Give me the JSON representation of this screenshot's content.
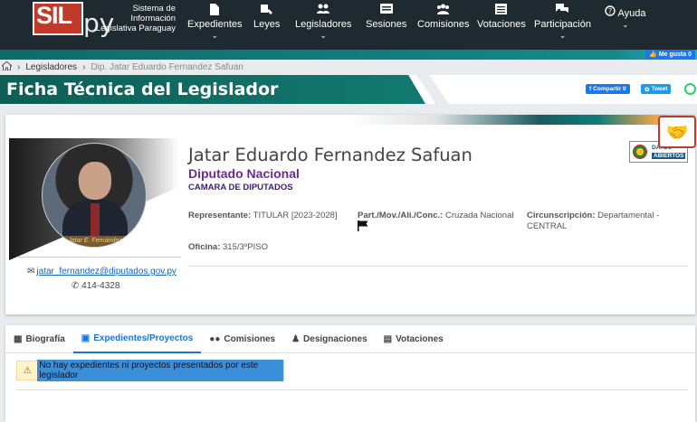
{
  "header": {
    "logo_sil": "SIL",
    "logo_py": "py",
    "logo_caption": "Sistema de Información Legislativa Paraguay",
    "nav": [
      {
        "label": "Expedientes",
        "icon": "document-icon",
        "dropdown": true
      },
      {
        "label": "Leyes",
        "icon": "book-icon",
        "dropdown": false
      },
      {
        "label": "Legisladores",
        "icon": "users-icon",
        "dropdown": true
      },
      {
        "label": "Sesiones",
        "icon": "keyboard-icon",
        "dropdown": false
      },
      {
        "label": "Comisiones",
        "icon": "group-icon",
        "dropdown": false
      },
      {
        "label": "Votaciones",
        "icon": "vote-icon",
        "dropdown": false
      },
      {
        "label": "Participación",
        "icon": "chat-icon",
        "dropdown": true
      },
      {
        "label": "Ayuda",
        "icon": "question-icon",
        "dropdown": true
      }
    ],
    "fb_like": "Me gusta 0"
  },
  "breadcrumb": {
    "items": [
      "Legisladores"
    ],
    "current": "Dip. Jatar Eduardo Fernandez Safuan"
  },
  "title": "Ficha Técnica del Legislador",
  "share": {
    "facebook": "Compartir 0",
    "twitter": "Tweet"
  },
  "profile": {
    "name": "Jatar Eduardo Fernandez Safuan",
    "role": "Diputado Nacional",
    "chamber": "CAMARA DE DIPUTADOS",
    "nameplate": "Jatar E. Fernández",
    "email": "jatar_fernandez@diputados.gov.py",
    "phone": "414-4328",
    "representante_label": "Representante:",
    "representante_value": "TITULAR [2023-2028]",
    "partido_label": "Part./Mov./Ali./Conc.:",
    "partido_value": "Cruzada Nacional",
    "circ_label": "Circunscripción:",
    "circ_value": "Departamental - CENTRAL",
    "oficina_label": "Oficina:",
    "oficina_value": "315/3ºPISO",
    "datos_abiertos_1": "DATOS",
    "datos_abiertos_2": "ABIERTOS"
  },
  "tabs": [
    {
      "label": "Biografía",
      "icon": "id-badge-icon",
      "active": false
    },
    {
      "label": "Expedientes/Proyectos",
      "icon": "file-icon",
      "active": true
    },
    {
      "label": "Comisiones",
      "icon": "group-icon",
      "active": false
    },
    {
      "label": "Designaciones",
      "icon": "user-edit-icon",
      "active": false
    },
    {
      "label": "Votaciones",
      "icon": "vote-icon",
      "active": false
    }
  ],
  "alert": "No hay expedientes ni proyectos presentados por este legislador",
  "colors": {
    "nav_bg": "#1f2a30",
    "title_green": "#117a70",
    "active_tab": "#1976d2",
    "role_purple": "#6a2c91"
  }
}
